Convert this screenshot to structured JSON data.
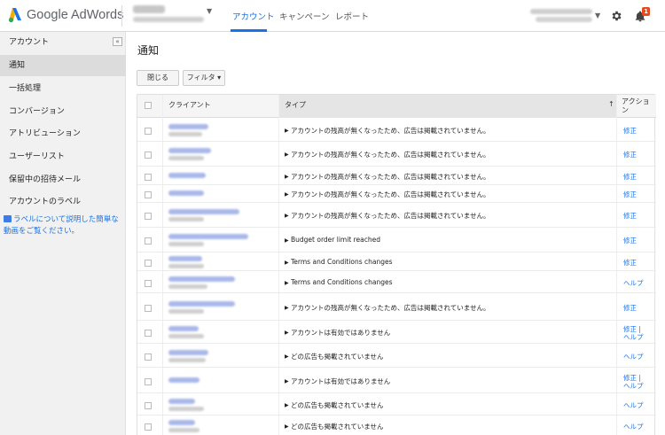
{
  "app": {
    "logo_text": "Google AdWords"
  },
  "topbar": {
    "nav_tabs": [
      "アカウント",
      "キャンペーン",
      "レポート"
    ],
    "notification_count": "1"
  },
  "sidebar": {
    "items": [
      "アカウント",
      "通知",
      "一括処理",
      "コンバージョン",
      "アトリビューション",
      "ユーザーリスト",
      "保留中の招待メール",
      "アカウントのラベル"
    ],
    "active": "通知",
    "collapse_label": "«",
    "help_link": "ラベルについて説明した簡単な動画をご覧ください。"
  },
  "main": {
    "title": "通知",
    "close_button": "閉じる",
    "filter_button": "フィルタ ▾"
  },
  "table": {
    "headers": {
      "client": "クライアント",
      "type": "タイプ",
      "action": "アクション"
    },
    "sort_indicator": "↑",
    "rows": [
      {
        "type": "アカウントの残高が無くなったため、広告は掲載されていません。",
        "action": "修正"
      },
      {
        "type": "アカウントの残高が無くなったため、広告は掲載されていません。",
        "action": "修正"
      },
      {
        "type": "アカウントの残高が無くなったため、広告は掲載されていません。",
        "action": "修正"
      },
      {
        "type": "アカウントの残高が無くなったため、広告は掲載されていません。",
        "action": "修正"
      },
      {
        "type": "アカウントの残高が無くなったため、広告は掲載されていません。",
        "action": "修正"
      },
      {
        "type": "Budget order limit reached",
        "action": "修正"
      },
      {
        "type": "Terms and Conditions changes",
        "action": "修正"
      },
      {
        "type": "Terms and Conditions changes",
        "action": "ヘルプ"
      },
      {
        "type": "アカウントの残高が無くなったため、広告は掲載されていません。",
        "action": "修正"
      },
      {
        "type": "アカウントは有効ではありません",
        "action": "修正 |",
        "action2": "ヘルプ"
      },
      {
        "type": "どの広告も掲載されていません",
        "action": "ヘルプ"
      },
      {
        "type": "アカウントは有効ではありません",
        "action": "修正 |",
        "action2": "ヘルプ"
      },
      {
        "type": "どの広告も掲載されていません",
        "action": "ヘルプ"
      },
      {
        "type": "どの広告も掲載されていません",
        "action": "ヘルプ"
      }
    ]
  },
  "colors": {
    "accent": "#1a73e8",
    "badge": "#e8491d",
    "sidebar_bg": "#f1f1f1"
  }
}
